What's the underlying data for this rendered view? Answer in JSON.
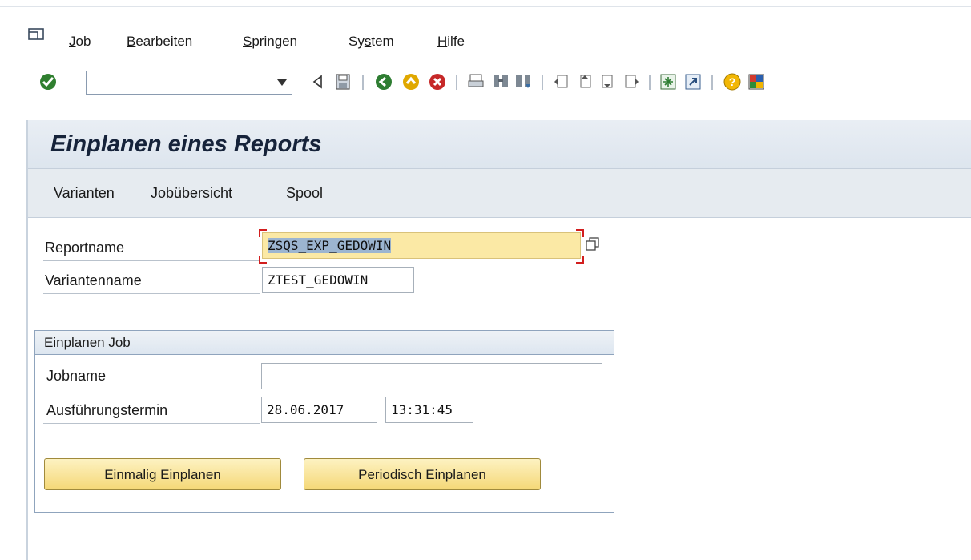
{
  "menu": {
    "items": [
      {
        "first": "J",
        "rest": "ob"
      },
      {
        "first": "B",
        "rest": "earbeiten"
      },
      {
        "first": "S",
        "rest": "pringen"
      },
      {
        "first": "Sy",
        "mid": "s",
        "rest": "tem"
      },
      {
        "first": "H",
        "rest": "ilfe"
      }
    ]
  },
  "toolbar": {
    "command_value": "",
    "icons": [
      "enter-icon",
      "back-icon",
      "save-icon",
      "back-green-icon",
      "exit-icon",
      "cancel-icon",
      "print-icon",
      "find-icon",
      "find-next-icon",
      "first-page-icon",
      "previous-page-icon",
      "next-page-icon",
      "last-page-icon",
      "create-session-icon",
      "shortcut-icon",
      "help-icon",
      "customize-layout-icon"
    ]
  },
  "page": {
    "title": "Einplanen eines Reports",
    "app_buttons": [
      "Varianten",
      "Jobübersicht",
      "Spool"
    ]
  },
  "form": {
    "reportname_label": "Reportname",
    "reportname_value": "ZSQS_EXP_GEDOWIN",
    "variant_label": "Variantenname",
    "variant_value": "ZTEST_GEDOWIN"
  },
  "job_group": {
    "title": "Einplanen Job",
    "jobname_label": "Jobname",
    "jobname_value": "",
    "date_label": "Ausführungstermin",
    "date_value": "28.06.2017",
    "time_value": "13:31:45",
    "button_once": "Einmalig Einplanen",
    "button_periodic": "Periodisch Einplanen"
  }
}
